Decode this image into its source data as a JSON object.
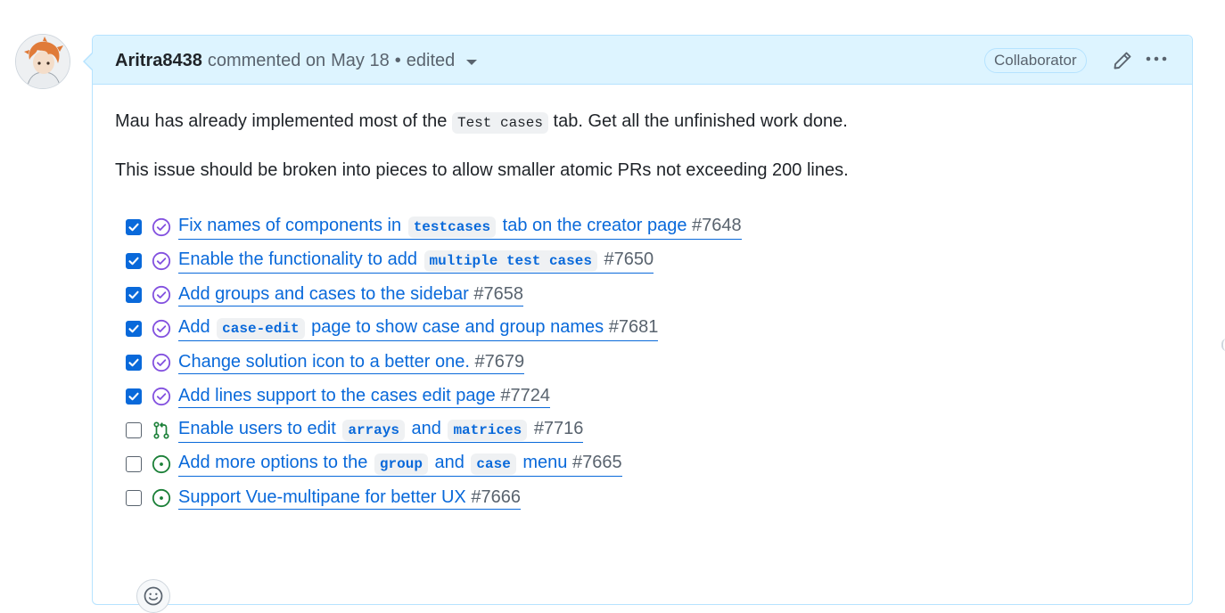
{
  "comment": {
    "author": "Aritra8438",
    "verb": "commented on",
    "date": "May 18",
    "separator": "•",
    "edited_label": "edited",
    "role_badge": "Collaborator",
    "paragraphs": [
      {
        "before": "Mau has already implemented most of the ",
        "code": "Test cases",
        "after": " tab. Get all the unfinished work done."
      },
      {
        "text": "This issue should be broken into pieces to allow smaller atomic PRs not exceeding 200 lines."
      }
    ],
    "tasks": [
      {
        "checked": true,
        "state": "merged-closed",
        "segments": [
          {
            "text": "Fix names of components in "
          },
          {
            "code": "testcases"
          },
          {
            "text": " tab on the creator page "
          }
        ],
        "number": "#7648"
      },
      {
        "checked": true,
        "state": "merged-closed",
        "segments": [
          {
            "text": "Enable the functionality to add "
          },
          {
            "code": "multiple test cases"
          },
          {
            "text": " "
          }
        ],
        "number": "#7650"
      },
      {
        "checked": true,
        "state": "merged-closed",
        "segments": [
          {
            "text": "Add groups and cases to the sidebar "
          }
        ],
        "number": "#7658"
      },
      {
        "checked": true,
        "state": "merged-closed",
        "segments": [
          {
            "text": "Add "
          },
          {
            "code": "case-edit"
          },
          {
            "text": " page to show case and group names "
          }
        ],
        "number": "#7681"
      },
      {
        "checked": true,
        "state": "merged-closed",
        "segments": [
          {
            "text": "Change solution icon to a better one. "
          }
        ],
        "number": "#7679"
      },
      {
        "checked": true,
        "state": "merged-closed",
        "segments": [
          {
            "text": "Add lines support to the cases edit page "
          }
        ],
        "number": "#7724"
      },
      {
        "checked": false,
        "state": "open-pull-request",
        "segments": [
          {
            "text": "Enable users to edit "
          },
          {
            "code": "arrays"
          },
          {
            "text": " and "
          },
          {
            "code": "matrices"
          },
          {
            "text": " "
          }
        ],
        "number": "#7716"
      },
      {
        "checked": false,
        "state": "open-issue",
        "segments": [
          {
            "text": "Add more options to the "
          },
          {
            "code": "group"
          },
          {
            "text": " and "
          },
          {
            "code": "case"
          },
          {
            "text": " menu "
          }
        ],
        "number": "#7665"
      },
      {
        "checked": false,
        "state": "open-issue",
        "segments": [
          {
            "text": "Support Vue-multipane for better UX "
          }
        ],
        "number": "#7666"
      }
    ]
  },
  "icons": {
    "edit": "pencil-icon",
    "more": "kebab-horizontal-icon",
    "reaction": "smiley-icon",
    "merged_closed": "check-circle-icon",
    "open_pull_request": "git-pull-request-icon",
    "open_issue": "issue-opened-icon"
  },
  "colors": {
    "link": "#0969da",
    "header_bg": "#ddf4ff",
    "border": "#b6e3ff",
    "done_purple": "#8250df",
    "open_green": "#1a7f37",
    "muted": "#59636e"
  }
}
